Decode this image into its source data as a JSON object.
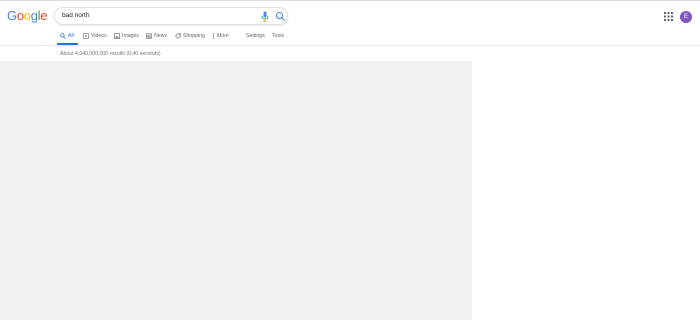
{
  "logo": {
    "letters": [
      "G",
      "o",
      "o",
      "g",
      "l",
      "e"
    ],
    "colors": [
      "#4285F4",
      "#EA4335",
      "#FBBC05",
      "#4285F4",
      "#34A853",
      "#EA4335"
    ]
  },
  "search": {
    "query": "bad north"
  },
  "account": {
    "initial": "E",
    "color": "#7e57c2"
  },
  "tabs": [
    {
      "label": "All",
      "icon": "search-icon"
    },
    {
      "label": "Videos",
      "icon": "video-icon"
    },
    {
      "label": "Images",
      "icon": "image-icon"
    },
    {
      "label": "News",
      "icon": "news-icon"
    },
    {
      "label": "Shopping",
      "icon": "tag-icon"
    },
    {
      "label": "More",
      "icon": "more-vert-icon"
    },
    {
      "label": "Settings"
    },
    {
      "label": "Tools"
    }
  ],
  "result_stats": "About 4,040,000,000 results (0.40 seconds)",
  "accent": "#1a73e8"
}
